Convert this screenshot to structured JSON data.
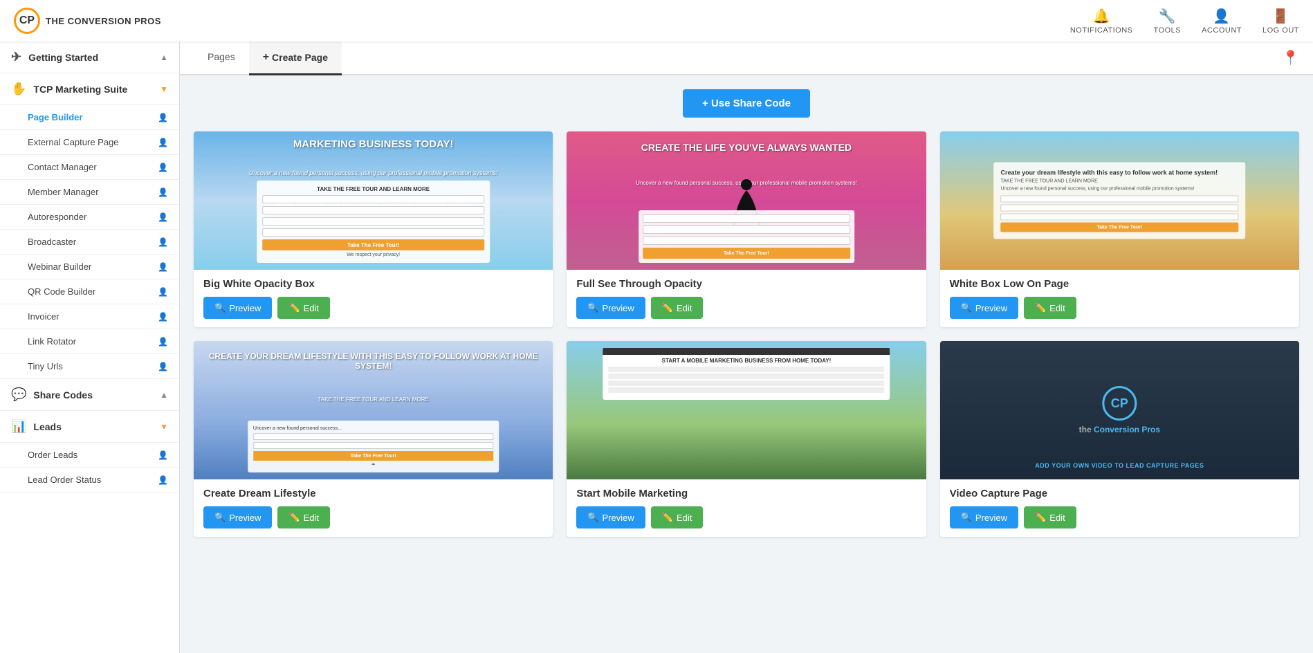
{
  "app": {
    "logo_initials": "CP",
    "logo_title": "THE CONVERSION PROS"
  },
  "topnav": {
    "items": [
      {
        "id": "notifications",
        "label": "NOTIFICATIONS",
        "icon": "🔔"
      },
      {
        "id": "tools",
        "label": "TOOLS",
        "icon": "🔧"
      },
      {
        "id": "account",
        "label": "ACCOUNT",
        "icon": "👤"
      },
      {
        "id": "logout",
        "label": "LOG OUT",
        "icon": "🚪"
      }
    ]
  },
  "sidebar": {
    "sections": [
      {
        "id": "getting-started",
        "label": "Getting Started",
        "icon": "✈",
        "expanded": true,
        "items": []
      },
      {
        "id": "tcp-marketing-suite",
        "label": "TCP Marketing Suite",
        "icon": "✋",
        "expanded": true,
        "items": [
          {
            "id": "page-builder",
            "label": "Page Builder",
            "active": true
          },
          {
            "id": "external-capture-page",
            "label": "External Capture Page",
            "active": false
          },
          {
            "id": "contact-manager",
            "label": "Contact Manager",
            "active": false
          },
          {
            "id": "member-manager",
            "label": "Member Manager",
            "active": false
          },
          {
            "id": "autoresponder",
            "label": "Autoresponder",
            "active": false
          },
          {
            "id": "broadcaster",
            "label": "Broadcaster",
            "active": false
          },
          {
            "id": "webinar-builder",
            "label": "Webinar Builder",
            "active": false
          },
          {
            "id": "qr-code-builder",
            "label": "QR Code Builder",
            "active": false
          },
          {
            "id": "invoicer",
            "label": "Invoicer",
            "active": false
          },
          {
            "id": "link-rotator",
            "label": "Link Rotator",
            "active": false
          },
          {
            "id": "tiny-urls",
            "label": "Tiny Urls",
            "active": false
          }
        ]
      },
      {
        "id": "share-codes",
        "label": "Share Codes",
        "icon": "💬",
        "expanded": true,
        "items": []
      },
      {
        "id": "leads",
        "label": "Leads",
        "icon": "📊",
        "expanded": true,
        "items": [
          {
            "id": "order-leads",
            "label": "Order Leads",
            "active": false
          },
          {
            "id": "lead-order-status",
            "label": "Lead Order Status",
            "active": false
          }
        ]
      }
    ]
  },
  "tabs": {
    "items": [
      {
        "id": "pages",
        "label": "Pages",
        "active": false
      },
      {
        "id": "create-page",
        "label": "Create Page",
        "active": true,
        "prefix": "+"
      }
    ]
  },
  "buttons": {
    "use_share_code": "+ Use Share Code",
    "preview": "Preview",
    "edit": "Edit"
  },
  "pages": [
    {
      "id": "big-white-opacity-box",
      "title": "Big White Opacity Box",
      "preview_type": "blue",
      "headline": "MARKETING BUSINESS TODAY!",
      "subtext": "Uncover a new found personal success, using our professional mobile promotion systems!"
    },
    {
      "id": "full-see-through-opacity",
      "title": "Full See Through Opacity",
      "preview_type": "pink",
      "headline": "CREATE THE LIFE YOU'VE ALWAYS WANTED",
      "subtext": "Uncover a new found personal success..."
    },
    {
      "id": "white-box-low-on-page",
      "title": "White Box Low On Page",
      "preview_type": "beach",
      "headline": "Create your dream lifestyle with this easy to follow work at home system!",
      "subtext": "TAKE THE FREE TOUR AND LEARN MORE"
    },
    {
      "id": "create-dream-lifestyle",
      "title": "Create Dream Lifestyle",
      "preview_type": "sky",
      "headline": "CREATE YOUR DREAM LIFESTYLE WITH THIS EASY TO FOLLOW WORK AT HOME SYSTEM!",
      "subtext": "TAKE THE FREE TOUR AND LEARN MORE"
    },
    {
      "id": "start-mobile-marketing",
      "title": "Start Mobile Marketing",
      "preview_type": "mountain",
      "headline": "START A MOBILE MARKETING BUSINESS FROM HOME TODAY!",
      "subtext": ""
    },
    {
      "id": "video-capture-page",
      "title": "Video Capture Page",
      "preview_type": "dark",
      "headline": "",
      "subtext": "ADD YOUR OWN VIDEO TO LEAD CAPTURE PAGES"
    }
  ]
}
